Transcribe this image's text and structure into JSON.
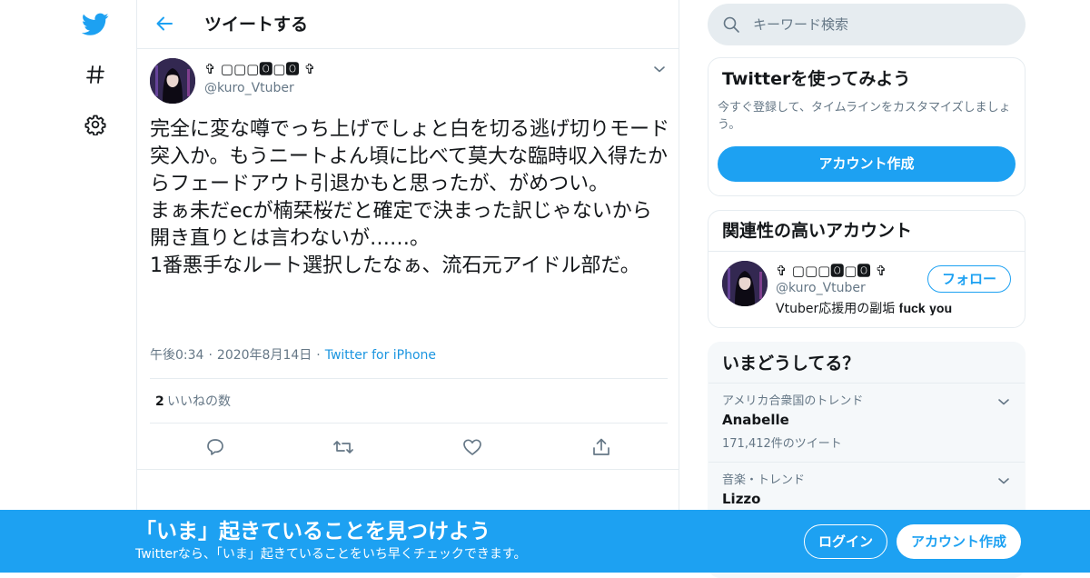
{
  "colors": {
    "accent": "#1da1f2",
    "text": "#14171a",
    "secondary": "#657786",
    "border": "#e6ecf0"
  },
  "nav": {
    "icons": [
      "twitter-logo-icon",
      "hashtag-icon",
      "gear-icon"
    ]
  },
  "header": {
    "title": "ツイートする"
  },
  "tweet": {
    "display_name": "✞ ▢▢▢🅾▢🅾 ✞",
    "handle": "@kuro_Vtuber",
    "text": "完全に変な噂でっち上げでしょと白を切る逃げ切りモード突入か。もうニートよん頃に比べて莫大な臨時収入得たからフェードアウト引退かもと思ったが、がめつい。\nまぁ未だecが楠栞桜だと確定で決まった訳じゃないから開き直りとは言わないが……。\n1番悪手なルート選択したなぁ、流石元アイドル部だ。",
    "time": "午後0:34",
    "date": "2020年8月14日",
    "source": "Twitter for iPhone",
    "likes_count": "2",
    "likes_label": "いいねの数"
  },
  "search": {
    "placeholder": "キーワード検索"
  },
  "signup_card": {
    "title": "Twitterを使ってみよう",
    "description": "今すぐ登録して、タイムラインをカスタマイズしましょう。",
    "button": "アカウント作成"
  },
  "related": {
    "title": "関連性の高いアカウント",
    "display_name": "✞ ▢▢▢🅾▢🅾 ✞",
    "handle": "@kuro_Vtuber",
    "bio": "Vtuber応援用の副垢 𝐟𝐮𝐜𝐤 𝐲𝐨𝐮",
    "follow_button": "フォロー"
  },
  "trends": {
    "title": "いまどうしてる？",
    "items": [
      {
        "context": "アメリカ合衆国のトレンド",
        "name": "Anabelle",
        "count": "171,412件のツイート"
      },
      {
        "context": "音楽・トレンド",
        "name": "Lizzo"
      }
    ]
  },
  "banner": {
    "title": "「いま」起きていることを見つけよう",
    "subtitle": "Twitterなら、「いま」起きていることをいち早くチェックできます。",
    "login": "ログイン",
    "signup": "アカウント作成"
  }
}
